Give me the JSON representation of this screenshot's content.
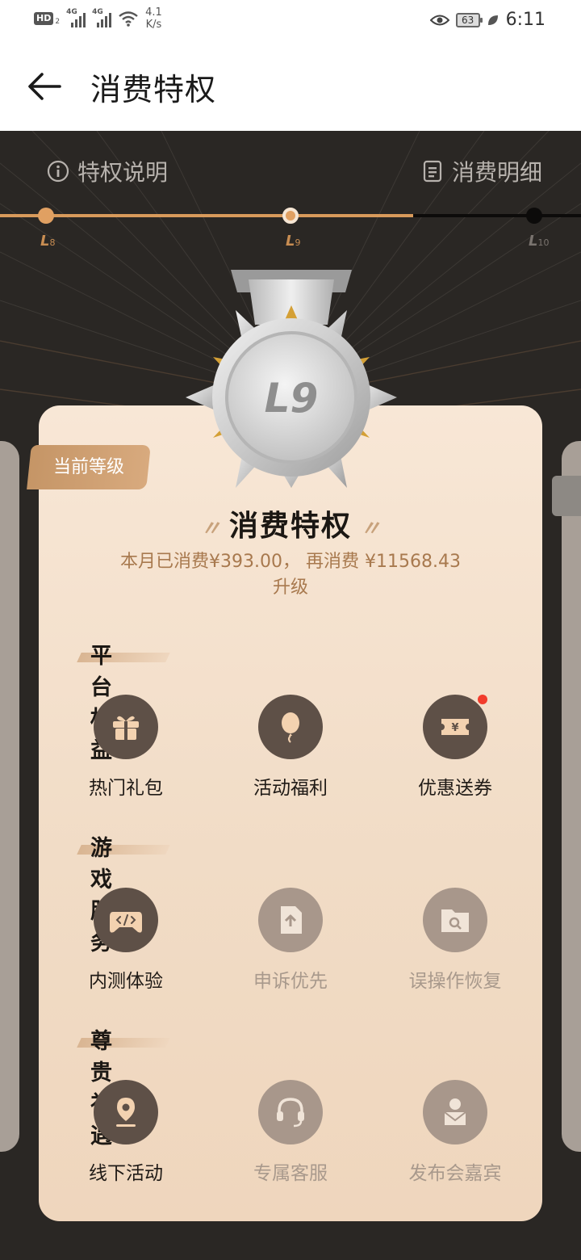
{
  "status_bar": {
    "hd": "HD",
    "sim_sub": "2",
    "signal_1": "4G",
    "signal_2": "4G",
    "speed_value": "4.1",
    "speed_unit": "K/s",
    "battery": "63",
    "time": "6:11"
  },
  "header": {
    "title": "消费特权"
  },
  "top_links": {
    "privilege_info": "特权说明",
    "consumption_detail": "消费明细"
  },
  "levels": [
    {
      "letter": "L",
      "num": "8"
    },
    {
      "letter": "L",
      "num": "9"
    },
    {
      "letter": "L",
      "num": "10"
    }
  ],
  "progress": {
    "current_level": "L9",
    "fraction": 0.71
  },
  "medal": {
    "text": "L9"
  },
  "card": {
    "current_badge": "当前等级",
    "title": "消费特权",
    "quote_open": "〃",
    "quote_close": "〃",
    "line1": "本月已消费¥393.00， 再消费 ¥11568.43",
    "line2": "升级"
  },
  "sections": [
    {
      "title": "平台权益",
      "items": [
        {
          "label": "热门礼包",
          "icon": "gift-icon",
          "enabled": true
        },
        {
          "label": "活动福利",
          "icon": "balloon-icon",
          "enabled": true
        },
        {
          "label": "优惠送券",
          "icon": "coupon-icon",
          "enabled": true,
          "red_dot": true
        }
      ]
    },
    {
      "title": "游戏服务",
      "items": [
        {
          "label": "内测体验",
          "icon": "gamepad-code-icon",
          "enabled": true
        },
        {
          "label": "申诉优先",
          "icon": "upload-document-icon",
          "enabled": false
        },
        {
          "label": "误操作恢复",
          "icon": "folder-search-icon",
          "enabled": false
        }
      ]
    },
    {
      "title": "尊贵礼遇",
      "items": [
        {
          "label": "线下活动",
          "icon": "location-pin-icon",
          "enabled": true
        },
        {
          "label": "专属客服",
          "icon": "headset-icon",
          "enabled": false
        },
        {
          "label": "发布会嘉宾",
          "icon": "vip-guest-icon",
          "enabled": false
        }
      ]
    }
  ],
  "colors": {
    "accent": "#d89a5b",
    "enabled_icon_bg": "#5e5047",
    "disabled_icon_bg": "#a8978b",
    "card_bg": "#f8e7d6",
    "dark_bg": "#2a2724",
    "notification_dot": "#f23c2c"
  }
}
